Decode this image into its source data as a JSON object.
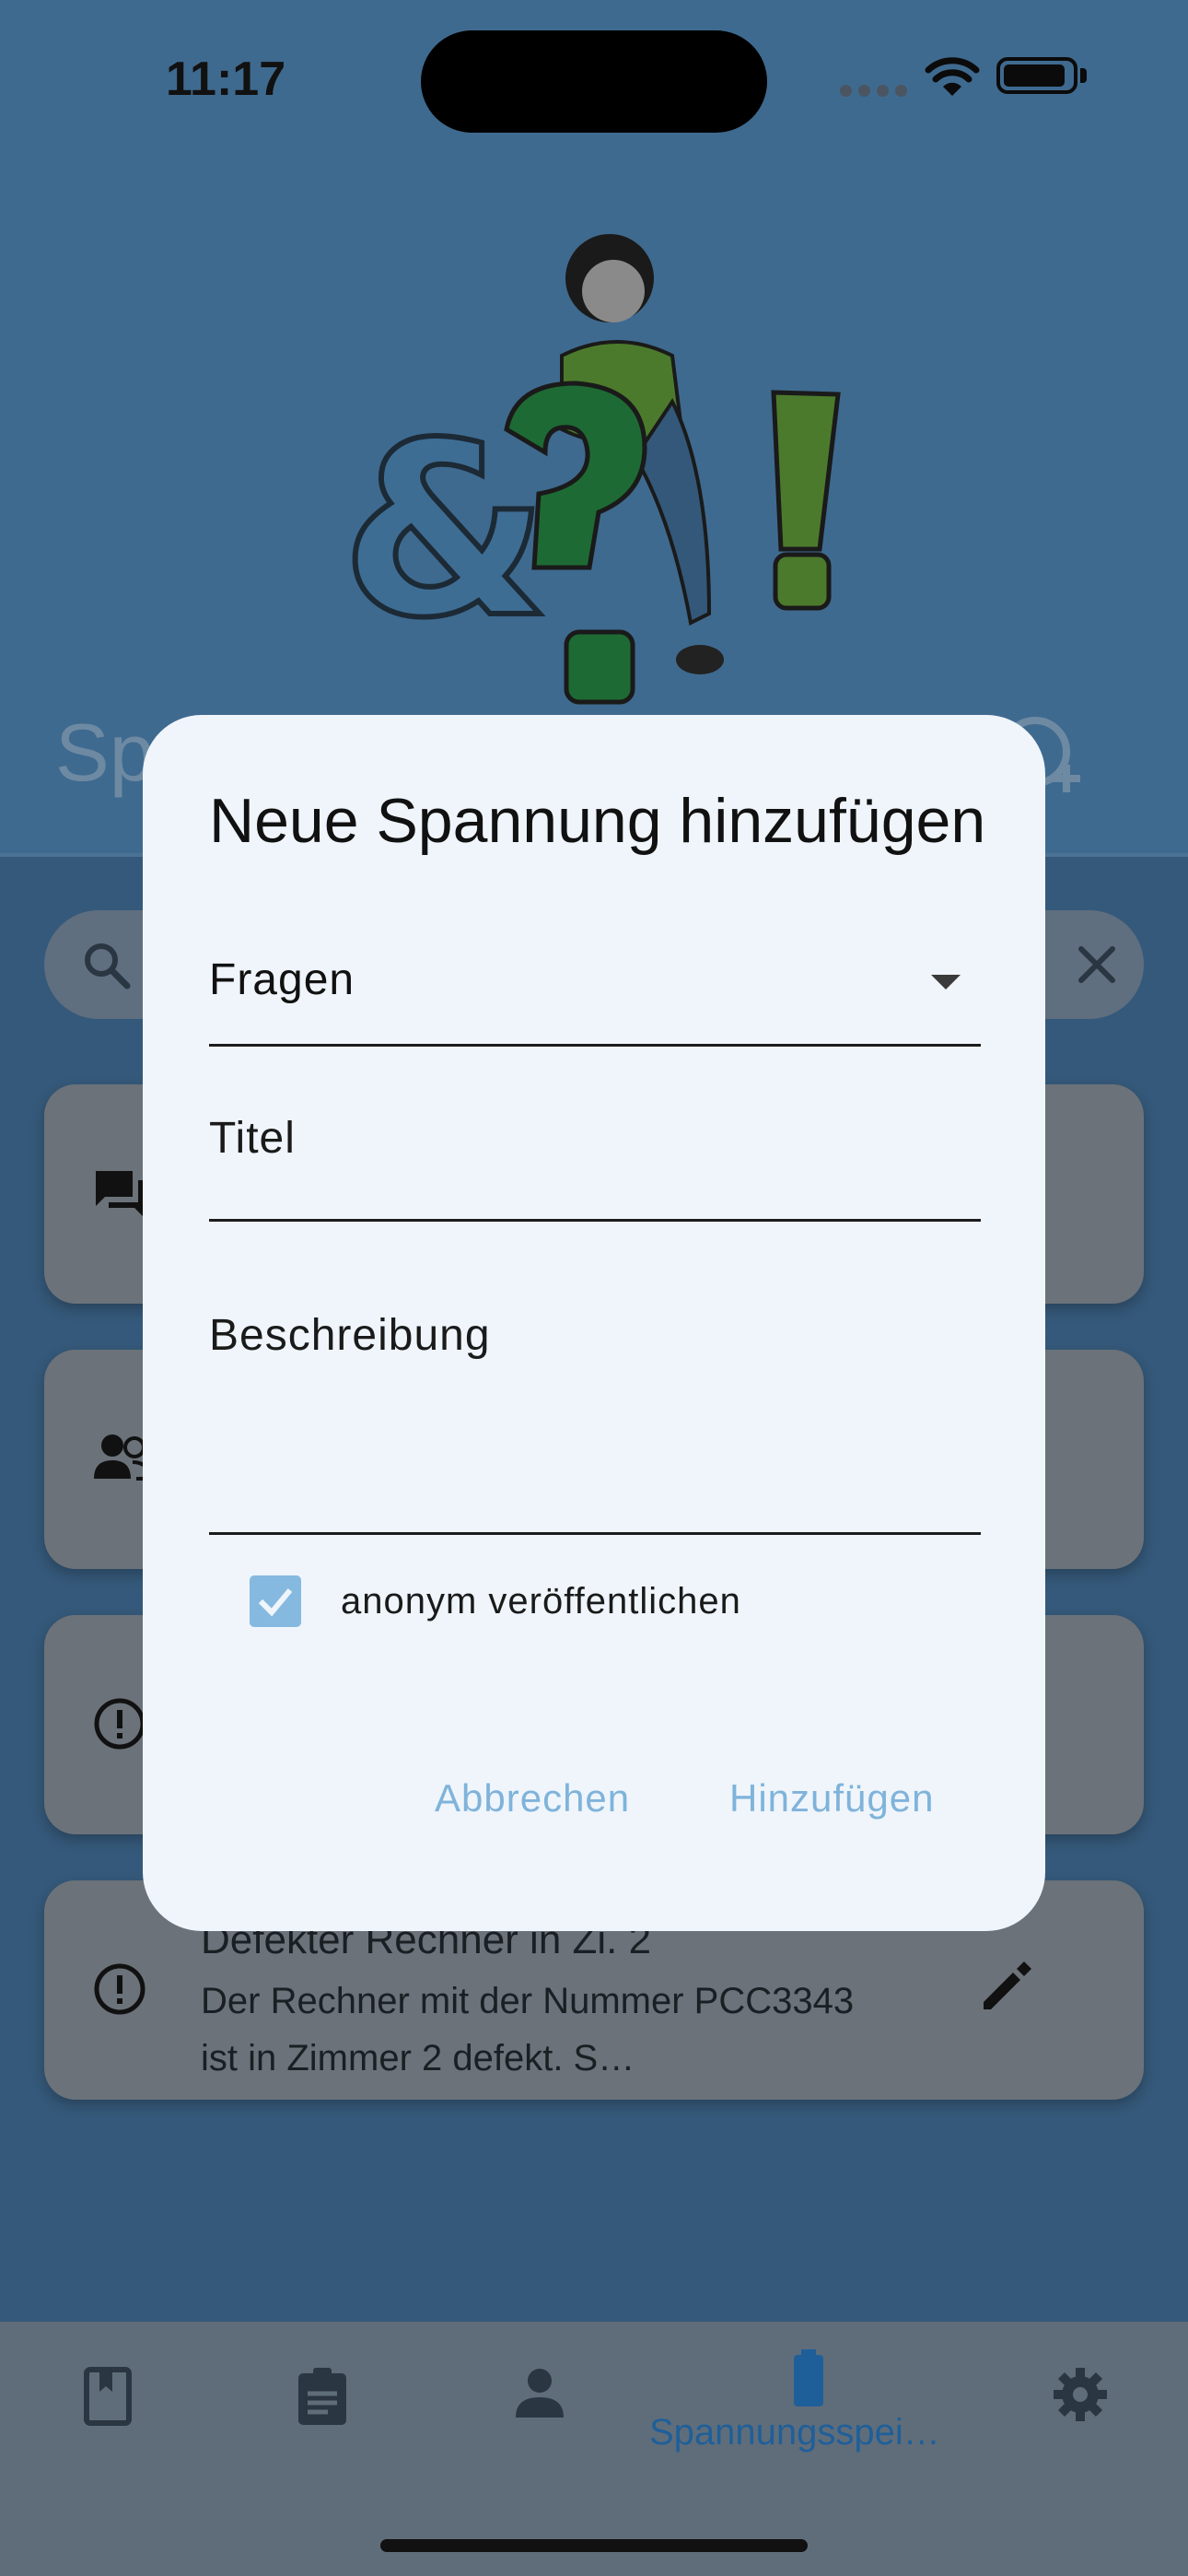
{
  "status_bar": {
    "time": "11:17"
  },
  "header": {
    "title": "Sp"
  },
  "search": {
    "placeholder": ""
  },
  "cards": [
    {
      "icon": "chat-icon",
      "title": "",
      "description": ""
    },
    {
      "icon": "group-icon",
      "title": "",
      "description": ""
    },
    {
      "icon": "alert-icon",
      "title": "",
      "description": ""
    },
    {
      "icon": "alert-icon",
      "title": "Defekter Rechner in Zi. 2",
      "description": "Der Rechner mit der Nummer PCC3343 ist in Zimmer 2 defekt. S…"
    }
  ],
  "bottom_nav": {
    "items": [
      {
        "icon": "book-icon",
        "label": ""
      },
      {
        "icon": "clipboard-icon",
        "label": ""
      },
      {
        "icon": "person-icon",
        "label": ""
      },
      {
        "icon": "battery-icon",
        "label": "Spannungsspei…",
        "active": true
      },
      {
        "icon": "gear-icon",
        "label": ""
      }
    ]
  },
  "dialog": {
    "title": "Neue Spannung hinzufügen",
    "category_value": "Fragen",
    "title_field_label": "Titel",
    "description_field_label": "Beschreibung",
    "anonymous_label": "anonym veröffentlichen",
    "anonymous_checked": true,
    "cancel_label": "Abbrechen",
    "add_label": "Hinzufügen"
  },
  "colors": {
    "accent": "#1f5f99",
    "dialog_bg": "#eff5fb",
    "button_text": "#7fb3da",
    "checkbox": "#86b9e0"
  }
}
